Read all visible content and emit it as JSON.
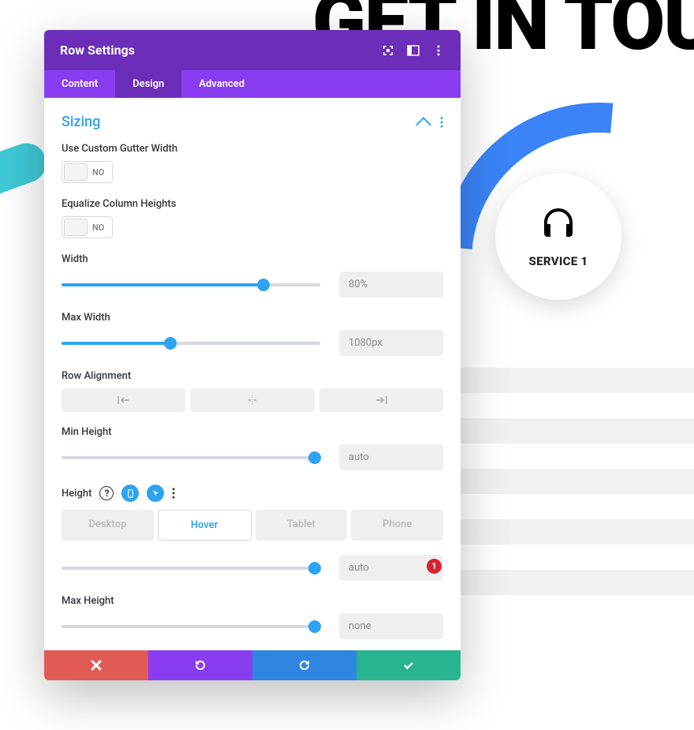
{
  "bg": {
    "text": "GET IN TOU"
  },
  "service": {
    "label": "SERVICE 1"
  },
  "modal": {
    "title": "Row Settings",
    "tabs": {
      "content": "Content",
      "design": "Design",
      "advanced": "Advanced"
    }
  },
  "section": {
    "title": "Sizing"
  },
  "fields": {
    "gutter": {
      "label": "Use Custom Gutter Width",
      "value": "NO"
    },
    "equalize": {
      "label": "Equalize Column Heights",
      "value": "NO"
    },
    "width": {
      "label": "Width",
      "value": "80%",
      "percent": 78
    },
    "maxWidth": {
      "label": "Max Width",
      "value": "1080px",
      "percent": 42
    },
    "rowAlign": {
      "label": "Row Alignment"
    },
    "minHeight": {
      "label": "Min Height",
      "value": "auto",
      "percent": 98
    },
    "height": {
      "label": "Height",
      "value": "auto",
      "percent": 98,
      "badge": "1",
      "devices": {
        "desktop": "Desktop",
        "hover": "Hover",
        "tablet": "Tablet",
        "phone": "Phone"
      }
    },
    "maxHeight": {
      "label": "Max Height",
      "value": "none",
      "percent": 98
    }
  }
}
